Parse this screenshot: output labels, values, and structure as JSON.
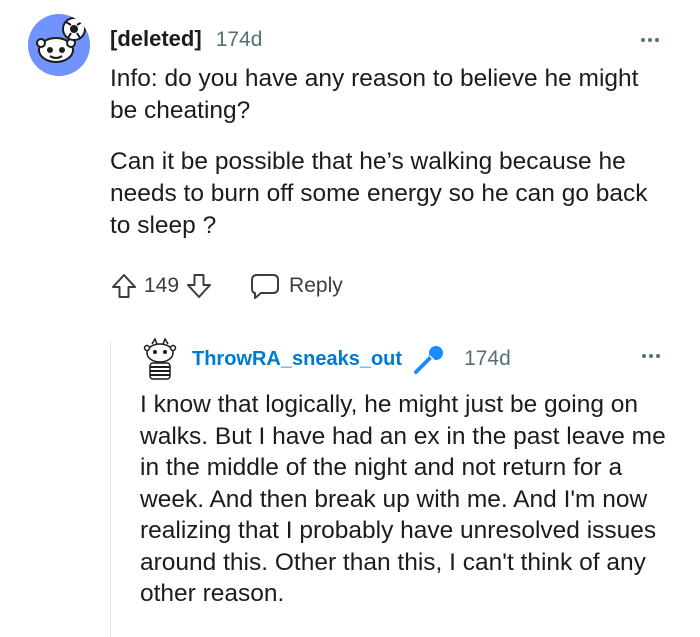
{
  "parent_comment": {
    "author": "[deleted]",
    "age": "174d",
    "paragraphs": [
      "Info: do you have any reason to believe he might be cheating?",
      "Can it be possible that he’s walking because he needs to burn off some energy so he can go back to sleep ?"
    ],
    "score": "149",
    "reply_label": "Reply"
  },
  "reply_comment": {
    "author": "ThrowRA_sneaks_out",
    "age": "174d",
    "text": "I know that logically, he might just be going on walks. But I have had an ex in the past leave me in the middle of the night and not return for a week. And then break up with me. And I'm now realizing that I probably have unresolved issues around this. Other than this, I can't think of any other reason."
  },
  "colors": {
    "reply_author": "#0079d3",
    "avatar_bg": "#7193ff",
    "meta_gray": "#576f76",
    "thread_line": "#e3e6e8",
    "mic": "#1a8cff"
  },
  "icons": [
    "snoo-avatar-icon",
    "more-options-icon",
    "upvote-icon",
    "downvote-icon",
    "comment-bubble-icon",
    "snoo-reply-avatar-icon",
    "microphone-icon"
  ]
}
